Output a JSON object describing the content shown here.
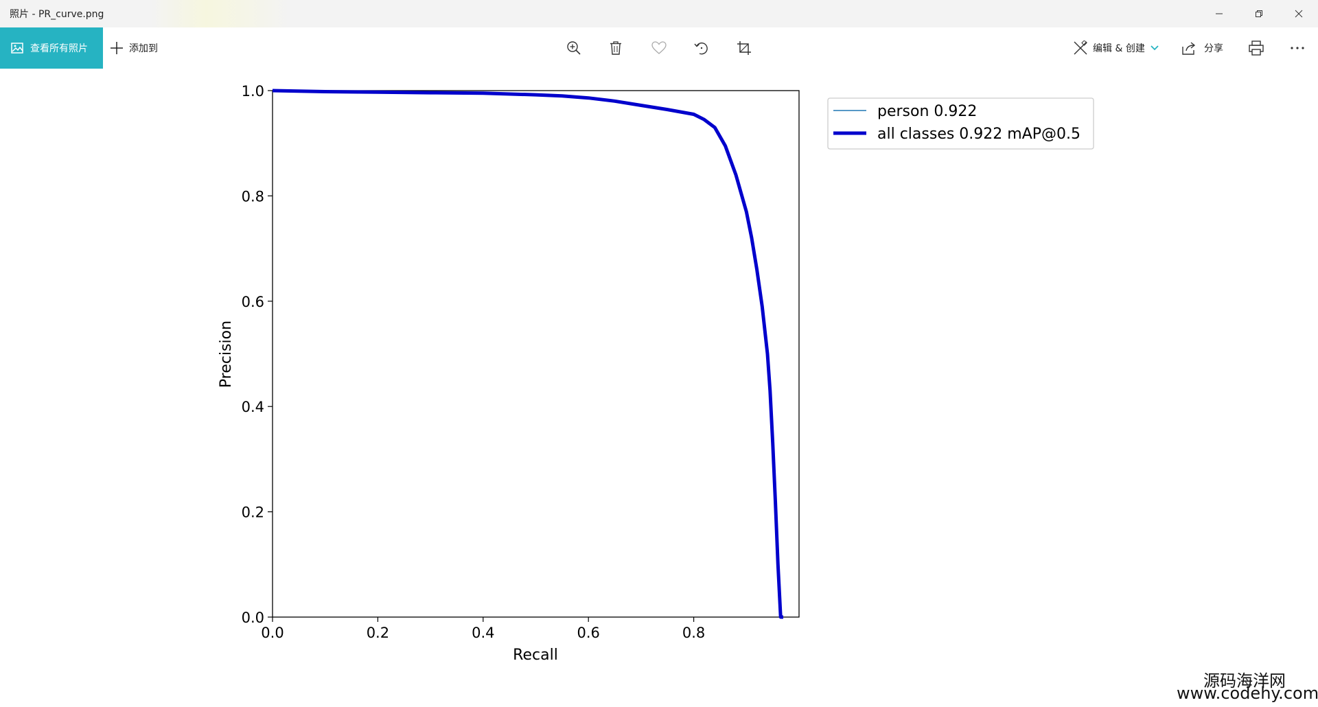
{
  "window": {
    "title": "照片 - PR_curve.png",
    "minimize_icon": "minimize-icon",
    "restore_icon": "restore-icon",
    "close_icon": "close-icon"
  },
  "toolbar": {
    "view_all_label": "查看所有照片",
    "add_to_label": "添加到",
    "edit_create_label": "编辑 & 创建",
    "share_label": "分享",
    "accent": "#26b3c2",
    "icons": [
      "zoom-icon",
      "delete-icon",
      "favorite-icon",
      "rotate-icon",
      "crop-icon",
      "print-icon",
      "more-icon"
    ]
  },
  "chart_data": {
    "type": "line",
    "title": "",
    "xlabel": "Recall",
    "ylabel": "Precision",
    "xlim": [
      0,
      1
    ],
    "ylim": [
      0,
      1
    ],
    "xticks": [
      "0.0",
      "0.2",
      "0.4",
      "0.6",
      "0.8"
    ],
    "yticks": [
      "0.0",
      "0.2",
      "0.4",
      "0.6",
      "0.8",
      "1.0"
    ],
    "legend_position": "outside-upper-right",
    "series": [
      {
        "name": "person 0.922",
        "color": "#1f77b4",
        "x": [
          0,
          0.1,
          0.2,
          0.3,
          0.4,
          0.5,
          0.55,
          0.6,
          0.65,
          0.7,
          0.75,
          0.8,
          0.82,
          0.84,
          0.86,
          0.88,
          0.9,
          0.91,
          0.92,
          0.93,
          0.94,
          0.945,
          0.95,
          0.955,
          0.96,
          0.965,
          0.97
        ],
        "y": [
          1.0,
          0.998,
          0.997,
          0.996,
          0.995,
          0.992,
          0.99,
          0.986,
          0.98,
          0.972,
          0.964,
          0.955,
          0.945,
          0.93,
          0.895,
          0.84,
          0.77,
          0.72,
          0.66,
          0.59,
          0.5,
          0.43,
          0.33,
          0.22,
          0.1,
          0.0,
          0.0
        ]
      },
      {
        "name": "all classes 0.922 mAP@0.5",
        "color": "#0000cc",
        "x": [
          0,
          0.1,
          0.2,
          0.3,
          0.4,
          0.5,
          0.55,
          0.6,
          0.65,
          0.7,
          0.75,
          0.8,
          0.82,
          0.84,
          0.86,
          0.88,
          0.9,
          0.91,
          0.92,
          0.93,
          0.94,
          0.945,
          0.95,
          0.955,
          0.96,
          0.965,
          0.97
        ],
        "y": [
          1.0,
          0.998,
          0.997,
          0.996,
          0.995,
          0.992,
          0.99,
          0.986,
          0.98,
          0.972,
          0.964,
          0.955,
          0.945,
          0.93,
          0.895,
          0.84,
          0.77,
          0.72,
          0.66,
          0.59,
          0.5,
          0.43,
          0.33,
          0.22,
          0.1,
          0.0,
          0.0
        ]
      }
    ]
  },
  "watermark": {
    "line1": "源码海洋网",
    "line2": "www.codehy.com"
  }
}
